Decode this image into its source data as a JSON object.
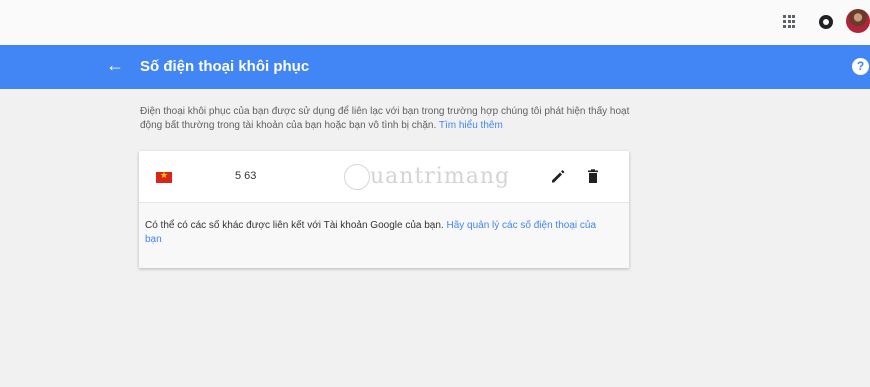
{
  "top_bar": {
    "apps_icon": "apps-grid-icon",
    "notifications_icon": "notifications-icon",
    "avatar": "user-avatar"
  },
  "header": {
    "title": "Số điện thoại khôi phục",
    "back_icon": "←",
    "help_icon": "?",
    "color": "#4285f4"
  },
  "description": {
    "text": "Điện thoại khôi phục của bạn được sử dụng để liên lạc với bạn trong trường hợp chúng tôi phát hiện thấy hoạt động bất thường trong tài khoản của bạn hoặc bạn vô tình bị chặn.",
    "learn_more": "Tìm hiểu thêm"
  },
  "phone_card": {
    "country_flag": "vietnam-flag",
    "number": "5 63",
    "watermark": "uantrimang",
    "edit_icon": "edit-icon",
    "delete_icon": "delete-icon"
  },
  "note": {
    "text": "Có thể có các số khác được liên kết với Tài khoản Google của bạn.",
    "link": "Hãy quản lý các số điện thoại của bạn"
  }
}
